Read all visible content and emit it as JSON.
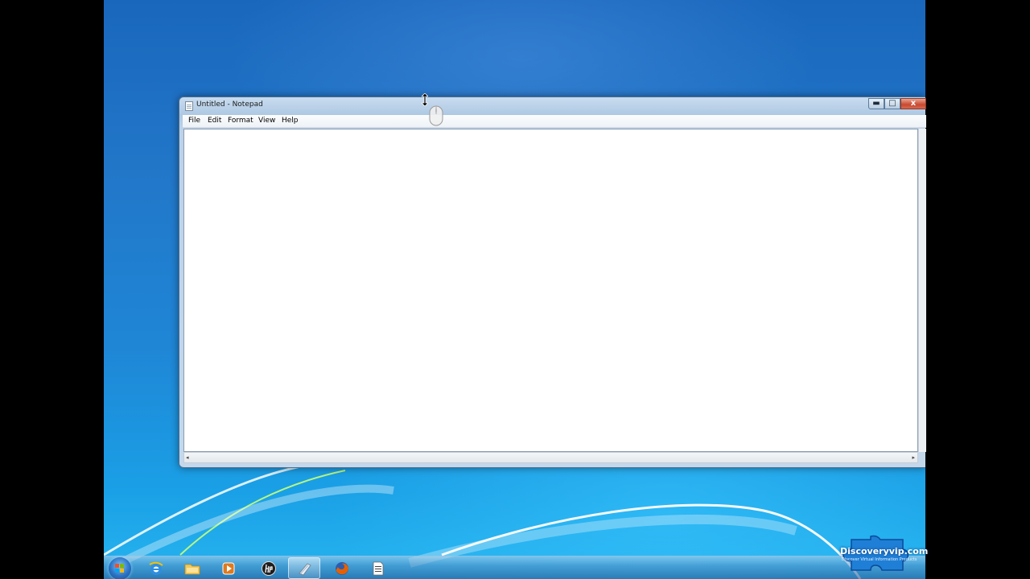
{
  "window": {
    "title": "Untitled - Notepad",
    "controls": {
      "minimize": "▬",
      "maximize": "□",
      "close": "x"
    }
  },
  "menubar": {
    "items": [
      "File",
      "Edit",
      "Format",
      "View",
      "Help"
    ]
  },
  "editor": {
    "content": ""
  },
  "scrollbar": {
    "left_arrow": "◂",
    "right_arrow": "▸"
  },
  "taskbar": {
    "items": [
      {
        "name": "start",
        "icon": "windows-orb-icon"
      },
      {
        "name": "internet-explorer",
        "icon": "ie-icon"
      },
      {
        "name": "windows-explorer",
        "icon": "folder-icon"
      },
      {
        "name": "media-player",
        "icon": "media-player-icon"
      },
      {
        "name": "hp",
        "icon": "hp-icon"
      },
      {
        "name": "notepad",
        "icon": "notepad-icon",
        "active": true
      },
      {
        "name": "firefox",
        "icon": "firefox-icon"
      },
      {
        "name": "document",
        "icon": "document-icon"
      }
    ]
  },
  "watermark": {
    "text": "Discoveryvip.com",
    "subtext": "Discover Virtual Information Products"
  },
  "colors": {
    "accent": "#1f86d6",
    "close_button": "#c8482f"
  }
}
